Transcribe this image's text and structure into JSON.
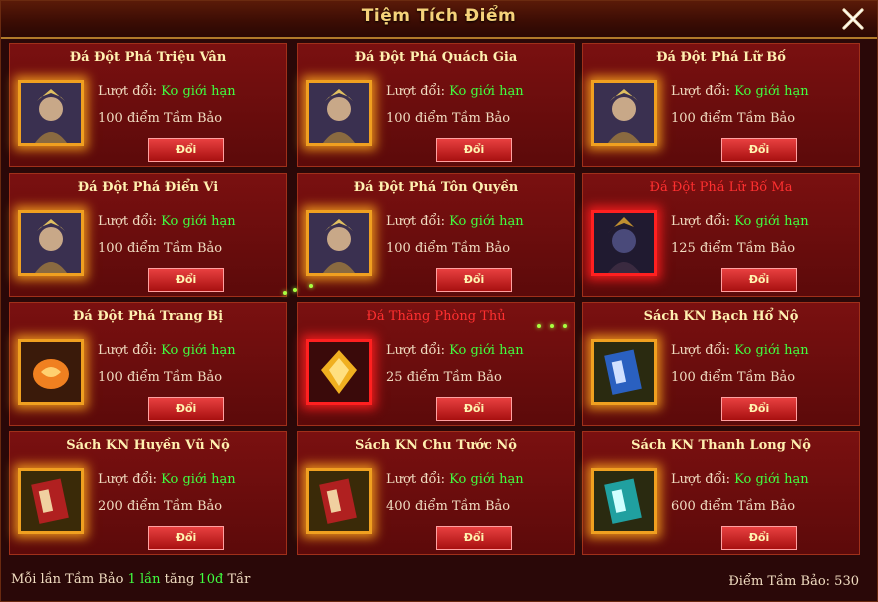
{
  "window": {
    "title": "Tiệm Tích Điểm",
    "close_icon": "close-x-icon"
  },
  "labels": {
    "exchange_limit": "Lượt đổi:",
    "points_unit": "điểm Tầm Bảo"
  },
  "items": [
    {
      "name": "Đá Đột Phá Triệu Vân",
      "limit": "Ko giới hạn",
      "cost": "100",
      "button": "Đổi",
      "icon": "zhao-yun-portrait-icon",
      "highlight": false
    },
    {
      "name": "Đá Đột Phá Quách Gia",
      "limit": "Ko giới hạn",
      "cost": "100",
      "button": "Đổi",
      "icon": "guo-jia-portrait-icon",
      "highlight": false
    },
    {
      "name": "Đá Đột Phá Lữ Bố",
      "limit": "Ko giới hạn",
      "cost": "100",
      "button": "Đổi",
      "icon": "lu-bu-portrait-icon",
      "highlight": false
    },
    {
      "name": "Đá Đột Phá Điển Vi",
      "limit": "Ko giới hạn",
      "cost": "100",
      "button": "Đổi",
      "icon": "dian-wei-portrait-icon",
      "highlight": false
    },
    {
      "name": "Đá Đột Phá Tôn Quyền",
      "limit": "Ko giới hạn",
      "cost": "100",
      "button": "Đổi",
      "icon": "sun-quan-portrait-icon",
      "highlight": false
    },
    {
      "name": "Đá Đột Phá Lữ Bố Ma",
      "limit": "Ko giới hạn",
      "cost": "125",
      "button": "Đổi",
      "icon": "demon-lu-bu-portrait-icon",
      "highlight": true
    },
    {
      "name": "Đá Đột Phá Trang Bị",
      "limit": "Ko giới hạn",
      "cost": "100",
      "button": "Đổi",
      "icon": "orange-stone-icon",
      "highlight": false
    },
    {
      "name": "Đá Thăng Phòng Thủ",
      "limit": "Ko giới hạn",
      "cost": "25",
      "button": "Đổi",
      "icon": "gold-shield-gem-icon",
      "highlight": true
    },
    {
      "name": "Sách KN Bạch Hổ Nộ",
      "limit": "Ko giới hạn",
      "cost": "100",
      "button": "Đổi",
      "icon": "blue-book-icon",
      "highlight": false
    },
    {
      "name": "Sách KN Huyền Vũ Nộ",
      "limit": "Ko giới hạn",
      "cost": "200",
      "button": "Đổi",
      "icon": "red-book-icon",
      "highlight": false
    },
    {
      "name": "Sách KN Chu Tước Nộ",
      "limit": "Ko giới hạn",
      "cost": "400",
      "button": "Đổi",
      "icon": "red-book-icon",
      "highlight": false
    },
    {
      "name": "Sách KN Thanh Long Nộ",
      "limit": "Ko giới hạn",
      "cost": "600",
      "button": "Đổi",
      "icon": "teal-book-icon",
      "highlight": false
    }
  ],
  "footer": {
    "info_prefix": "Mỗi lần Tầm Bảo",
    "info_count": "1 lần",
    "info_mid": "tăng",
    "info_points": "10đ",
    "info_suffix": "Tầr",
    "points_label": "Điểm Tầm Bảo:",
    "points_value": "530"
  },
  "colors": {
    "accent": "#f5d27a",
    "value_green": "#40ff40",
    "highlight_red": "#ff3030",
    "card_bg": "#6a0c0c"
  }
}
